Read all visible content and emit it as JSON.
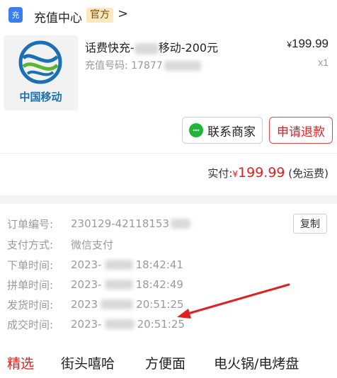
{
  "store": {
    "icon_glyph": "充",
    "name": "充值中心",
    "badge": "官方",
    "chevron": ">"
  },
  "product": {
    "logo_text": "中国移动",
    "title_prefix": "话费快充-",
    "title_suffix": "移动-200元",
    "account_label": "充值号码: ",
    "account_visible": "17877",
    "price_symbol": "¥",
    "price": "199.99",
    "quantity": "x1"
  },
  "actions": {
    "contact_label": "联系商家",
    "refund_label": "申请退款"
  },
  "payment": {
    "paid_label": "实付:",
    "currency": "¥",
    "amount": "199.99",
    "shipping_note": "(免运费)"
  },
  "order_info": {
    "order_no_label": "订单编号:",
    "order_no_visible": "230129-42118153",
    "copy_label": "复制",
    "pay_method_label": "支付方式:",
    "pay_method_value": "微信支付",
    "order_time_label": "下单时间:",
    "order_time_date": "2023-",
    "order_time_time": "18:42:41",
    "group_time_label": "拼单时间:",
    "group_time_date": "2023-",
    "group_time_time": "18:42:49",
    "ship_time_label": "发货时间:",
    "ship_time_date": "2023",
    "ship_time_time": "20:51:25",
    "deal_time_label": "成交时间:",
    "deal_time_date": "2023-",
    "deal_time_time": "20:51:25"
  },
  "categories": [
    "精选",
    "街头嘻哈",
    "方便面",
    "电火锅/电烤盘"
  ],
  "colors": {
    "accent_red": "#e02020",
    "wechat_green": "#1fb53a",
    "cmcc_blue": "#1b6fb5"
  }
}
